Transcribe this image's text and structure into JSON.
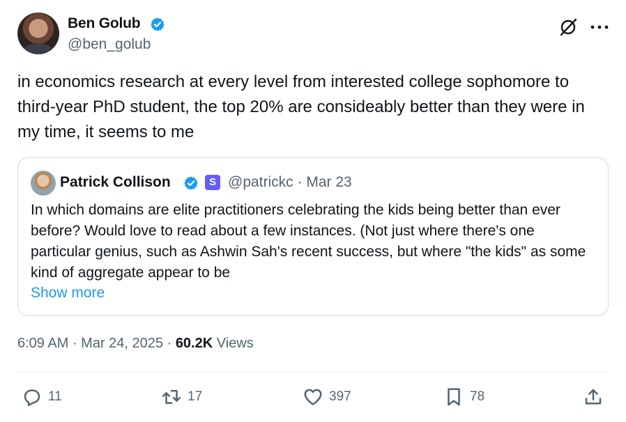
{
  "author": {
    "name": "Ben Golub",
    "handle": "@ben_golub"
  },
  "tweet": {
    "text": "in economics research at every level from interested college sophomore to third-year PhD student, the top 20% are consideably better than they were in my time, it seems to me"
  },
  "quote": {
    "name": "Patrick Collison",
    "badge_letter": "S",
    "meta": "@patrickc · Mar 23",
    "text": "In which domains are elite practitioners celebrating the kids being better than ever before? Would love to read about a few instances. (Not just where there's one particular genius, such as Ashwin Sah's recent success, but where \"the kids\" as some kind of aggregate appear to be",
    "show_more": "Show more"
  },
  "meta": {
    "time": "6:09 AM",
    "date": "Mar 24, 2025",
    "views_count": "60.2K",
    "views_label": "Views"
  },
  "actions": {
    "replies": "11",
    "reposts": "17",
    "likes": "397",
    "bookmarks": "78"
  },
  "icons": {
    "verified": "verified-badge-icon",
    "grok": "grok-icon",
    "more": "more-icon",
    "reply": "reply-icon",
    "repost": "repost-icon",
    "like": "like-icon",
    "bookmark": "bookmark-icon",
    "share": "share-icon"
  },
  "colors": {
    "verified": "#1d9bf0",
    "link": "#1d9bf0",
    "muted": "#536471",
    "stripe": "#635bff"
  }
}
